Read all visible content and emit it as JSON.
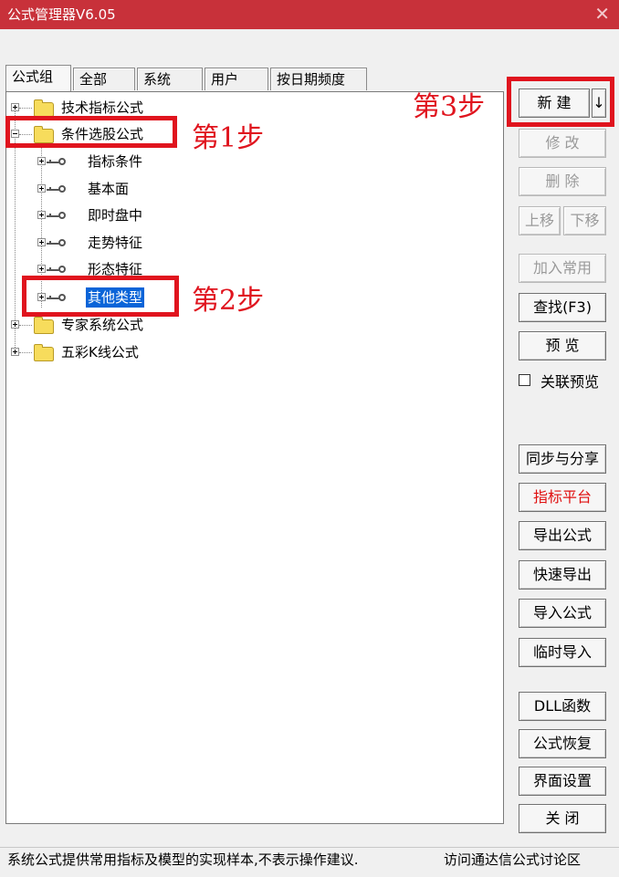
{
  "window": {
    "title": "公式管理器V6.05",
    "close_glyph": "✕"
  },
  "tabs": [
    "公式组",
    "全部",
    "系统",
    "用户",
    "按日期频度"
  ],
  "tree": {
    "groups": [
      {
        "label": "技术指标公式",
        "expanded": false
      },
      {
        "label": "条件选股公式",
        "expanded": true,
        "children": [
          "指标条件",
          "基本面",
          "即时盘中",
          "走势特征",
          "形态特征",
          "其他类型"
        ],
        "selected_child": "其他类型"
      },
      {
        "label": "专家系统公式",
        "expanded": false
      },
      {
        "label": "五彩K线公式",
        "expanded": false
      }
    ]
  },
  "annotations": {
    "step1": "第1步",
    "step2": "第2步",
    "step3": "第3步"
  },
  "buttons": {
    "new": "新 建",
    "new_arrow": "↓",
    "modify": "修 改",
    "delete": "删 除",
    "move_up": "上移",
    "move_down": "下移",
    "add_common": "加入常用",
    "find": "查找(F3)",
    "preview": "预 览",
    "linked_preview": "关联预览",
    "sync_share": "同步与分享",
    "indicator_platform": "指标平台",
    "export": "导出公式",
    "quick_export": "快速导出",
    "import": "导入公式",
    "temp_import": "临时导入",
    "dll": "DLL函数",
    "restore": "公式恢复",
    "ui_settings": "界面设置",
    "close": "关 闭"
  },
  "status": {
    "left": "系统公式提供常用指标及模型的实现样本,不表示操作建议.",
    "right": "访问通达信公式讨论区"
  },
  "colors": {
    "titlebar": "#c8313a",
    "highlight": "#e0141e",
    "selection": "#0a64d8"
  }
}
